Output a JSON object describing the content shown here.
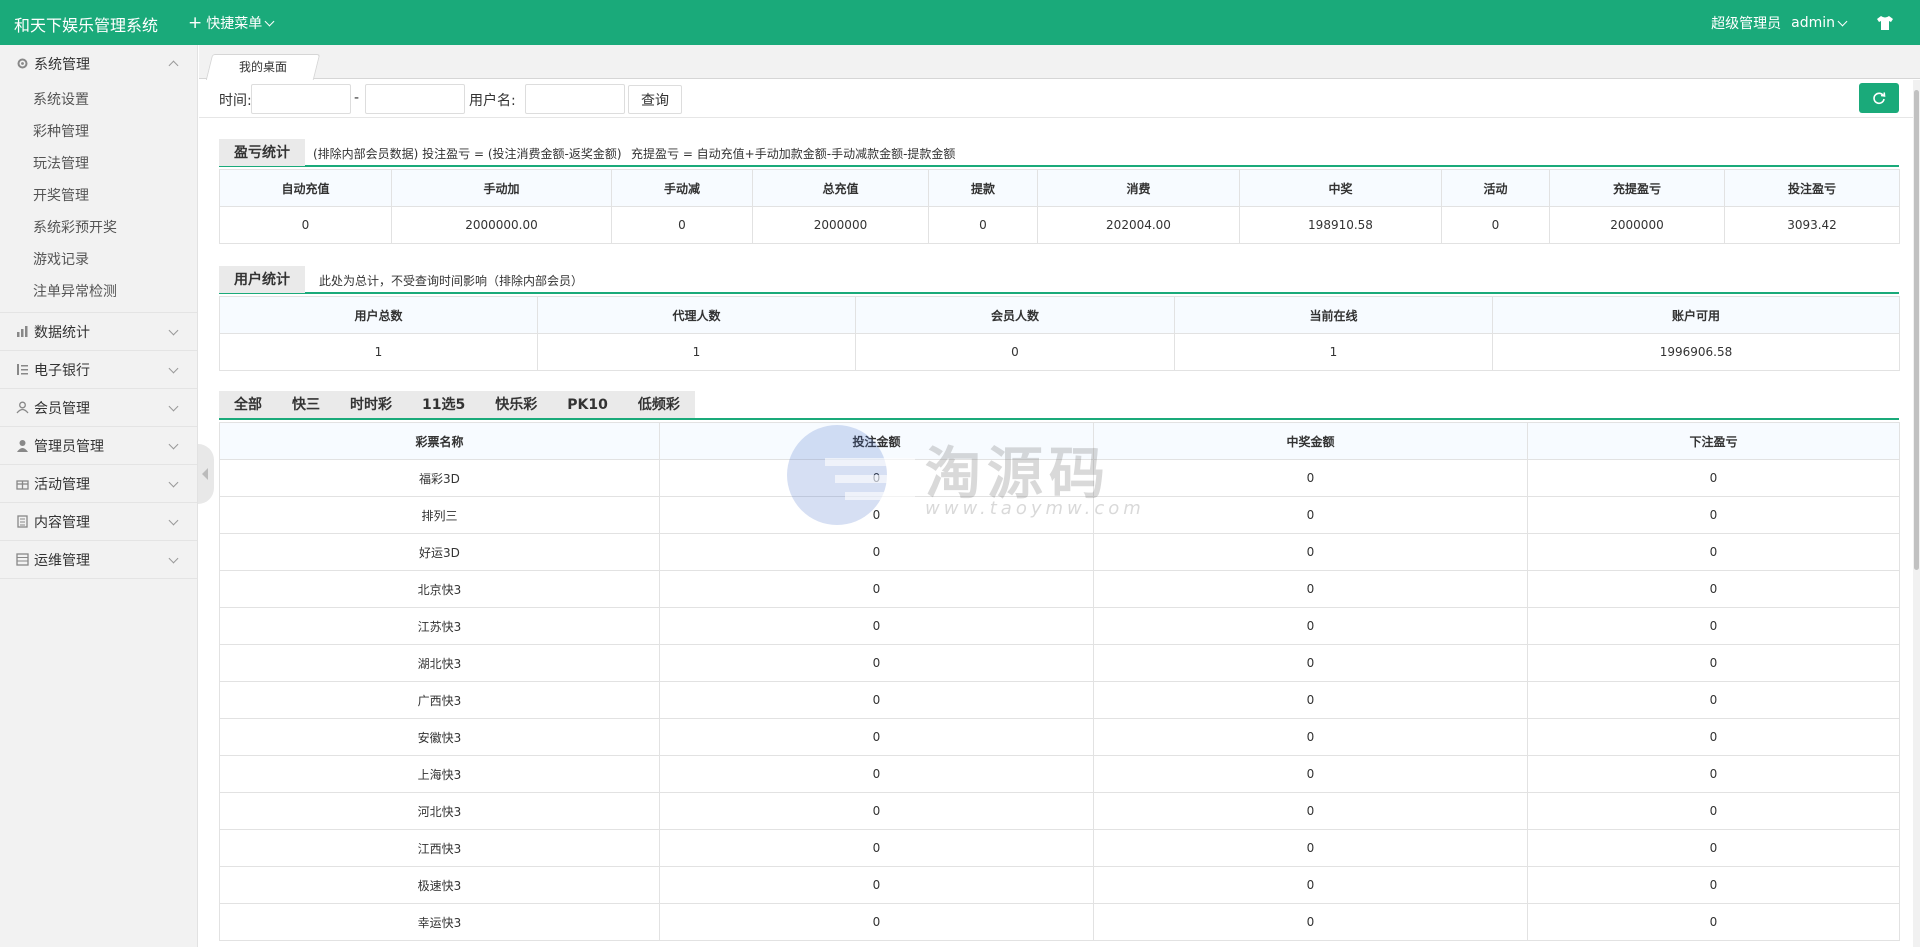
{
  "header": {
    "app_title": "和天下娱乐管理系统",
    "quick_menu": "快捷菜单",
    "role": "超级管理员",
    "username": "admin"
  },
  "sidebar": {
    "groups": [
      {
        "label": "系统管理",
        "icon": "gear-icon",
        "expanded": true,
        "items": [
          "系统设置",
          "彩种管理",
          "玩法管理",
          "开奖管理",
          "系统彩预开奖",
          "游戏记录",
          "注单异常检测"
        ]
      },
      {
        "label": "数据统计",
        "icon": "chart-icon"
      },
      {
        "label": "电子银行",
        "icon": "list-icon"
      },
      {
        "label": "会员管理",
        "icon": "user-icon"
      },
      {
        "label": "管理员管理",
        "icon": "admin-icon"
      },
      {
        "label": "活动管理",
        "icon": "gift-icon"
      },
      {
        "label": "内容管理",
        "icon": "document-icon"
      },
      {
        "label": "运维管理",
        "icon": "server-icon"
      }
    ]
  },
  "tabs": {
    "desktop": "我的桌面"
  },
  "filter": {
    "time_label": "时间:",
    "dash": "-",
    "user_label": "用户名:",
    "query_button": "查询"
  },
  "profit_section": {
    "title": "盈亏统计",
    "note1": "(排除内部会员数据)  投注盈亏 = (投注消费金额-返奖金额)",
    "note2": "充提盈亏 = 自动充值+手动加款金额-手动减款金额-提款金额",
    "headers": [
      "自动充值",
      "手动加",
      "手动减",
      "总充值",
      "提款",
      "消费",
      "中奖",
      "活动",
      "充提盈亏",
      "投注盈亏"
    ],
    "values": [
      "0",
      "2000000.00",
      "0",
      "2000000",
      "0",
      "202004.00",
      "198910.58",
      "0",
      "2000000",
      "3093.42"
    ]
  },
  "user_section": {
    "title": "用户统计",
    "note": "此处为总计，不受查询时间影响（排除内部会员）",
    "headers": [
      "用户总数",
      "代理人数",
      "会员人数",
      "当前在线",
      "账户可用"
    ],
    "values": [
      "1",
      "1",
      "0",
      "1",
      "1996906.58"
    ]
  },
  "lottery_tabs": [
    "全部",
    "快三",
    "时时彩",
    "11选5",
    "快乐彩",
    "PK10",
    "低频彩"
  ],
  "lottery_table": {
    "headers": [
      "彩票名称",
      "投注金额",
      "中奖金额",
      "下注盈亏"
    ],
    "rows": [
      [
        "福彩3D",
        "0",
        "0",
        "0"
      ],
      [
        "排列三",
        "0",
        "0",
        "0"
      ],
      [
        "好运3D",
        "0",
        "0",
        "0"
      ],
      [
        "北京快3",
        "0",
        "0",
        "0"
      ],
      [
        "江苏快3",
        "0",
        "0",
        "0"
      ],
      [
        "湖北快3",
        "0",
        "0",
        "0"
      ],
      [
        "广西快3",
        "0",
        "0",
        "0"
      ],
      [
        "安徽快3",
        "0",
        "0",
        "0"
      ],
      [
        "上海快3",
        "0",
        "0",
        "0"
      ],
      [
        "河北快3",
        "0",
        "0",
        "0"
      ],
      [
        "江西快3",
        "0",
        "0",
        "0"
      ],
      [
        "极速快3",
        "0",
        "0",
        "0"
      ],
      [
        "幸运快3",
        "0",
        "0",
        "0"
      ]
    ]
  },
  "watermark": {
    "text": "淘源码",
    "url": "www.taoymw.com"
  },
  "colors": {
    "brand": "#1aaa7a",
    "sidebar_bg": "#f2f2f2",
    "table_header_bg": "#f7fbff"
  }
}
